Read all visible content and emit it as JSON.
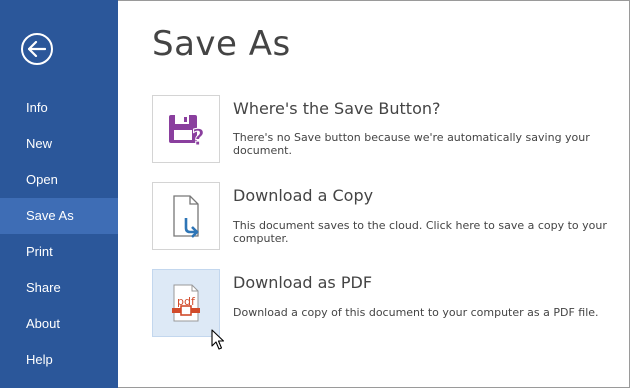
{
  "sidebar": {
    "items": [
      {
        "label": "Info"
      },
      {
        "label": "New"
      },
      {
        "label": "Open"
      },
      {
        "label": "Save As",
        "active": true
      },
      {
        "label": "Print"
      },
      {
        "label": "Share"
      },
      {
        "label": "About"
      },
      {
        "label": "Help"
      }
    ],
    "back_icon": "back-arrow-icon",
    "colors": {
      "background": "#2b579a",
      "active": "#3e6db5",
      "text": "#ffffff"
    }
  },
  "main": {
    "title": "Save As",
    "options": [
      {
        "title": "Where's the Save Button?",
        "description": "There's no Save button because we're automatically saving your document.",
        "icon": "floppy-question-icon"
      },
      {
        "title": "Download a Copy",
        "description": "This document saves to the cloud. Click here to save a copy to your computer.",
        "icon": "document-download-icon"
      },
      {
        "title": "Download as PDF",
        "description": "Download a copy of this document to your computer as a PDF file.",
        "icon": "pdf-file-icon",
        "hovered": true,
        "icon_text": "pdf"
      }
    ]
  },
  "cursor": {
    "icon": "mouse-pointer-icon"
  }
}
